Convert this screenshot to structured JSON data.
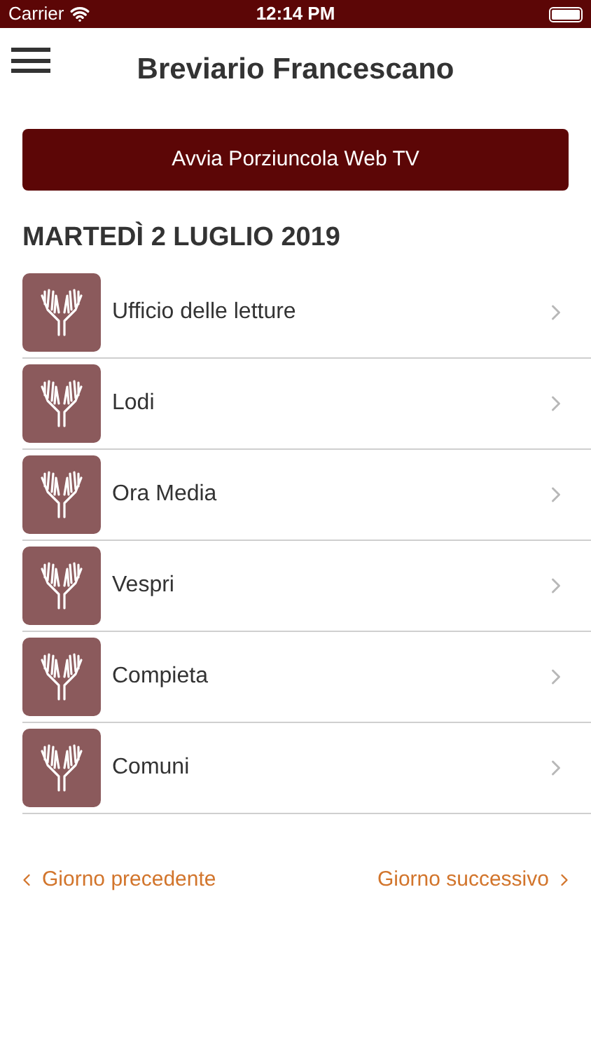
{
  "status_bar": {
    "carrier": "Carrier",
    "time": "12:14 PM"
  },
  "header": {
    "title": "Breviario Francescano"
  },
  "tv_button": {
    "label": "Avvia Porziuncola Web TV"
  },
  "date": "MARTEDÌ 2 LUGLIO 2019",
  "hours": [
    {
      "label": "Ufficio delle letture"
    },
    {
      "label": "Lodi"
    },
    {
      "label": "Ora Media"
    },
    {
      "label": "Vespri"
    },
    {
      "label": "Compieta"
    },
    {
      "label": "Comuni"
    }
  ],
  "nav": {
    "previous": "Giorno precedente",
    "next": "Giorno successivo"
  }
}
